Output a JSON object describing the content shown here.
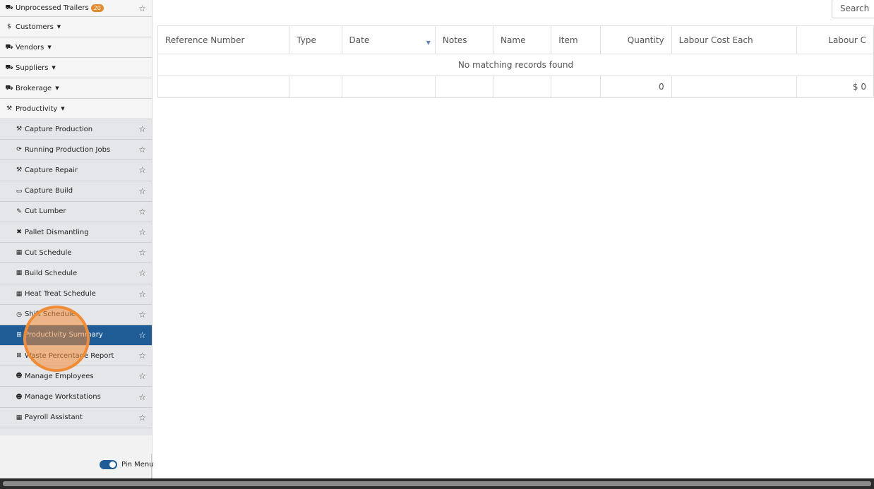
{
  "sidebar": {
    "top_items": [
      {
        "label": "Unprocessed Trailers",
        "icon": "truck-icon",
        "badge": "20",
        "starred": true
      },
      {
        "label": "Customers",
        "icon": "dollar-icon"
      },
      {
        "label": "Vendors",
        "icon": "truck-icon"
      },
      {
        "label": "Suppliers",
        "icon": "truck-icon"
      },
      {
        "label": "Brokerage",
        "icon": "truck-icon"
      },
      {
        "label": "Productivity",
        "icon": "hammer-icon"
      }
    ],
    "productivity_items": [
      {
        "label": "Capture Production",
        "icon": "hammer-icon"
      },
      {
        "label": "Running Production Jobs",
        "icon": "refresh-icon"
      },
      {
        "label": "Capture Repair",
        "icon": "hammer-icon"
      },
      {
        "label": "Capture Build",
        "icon": "ruler-icon"
      },
      {
        "label": "Cut Lumber",
        "icon": "wrench-icon"
      },
      {
        "label": "Pallet Dismantling",
        "icon": "tools-icon"
      },
      {
        "label": "Cut Schedule",
        "icon": "calendar-icon"
      },
      {
        "label": "Build Schedule",
        "icon": "calendar-icon"
      },
      {
        "label": "Heat Treat Schedule",
        "icon": "calendar-icon"
      },
      {
        "label": "Shift Schedule",
        "icon": "clock-icon"
      },
      {
        "label": "Productivity Summary",
        "icon": "table-icon",
        "active": true
      },
      {
        "label": "Waste Percentage Report",
        "icon": "table-icon"
      },
      {
        "label": "Manage Employees",
        "icon": "users-icon"
      },
      {
        "label": "Manage Workstations",
        "icon": "users-icon"
      },
      {
        "label": "Payroll Assistant",
        "icon": "calendar-icon"
      }
    ],
    "pin_menu_label": "Pin Menu"
  },
  "search": {
    "placeholder": "Search"
  },
  "table": {
    "columns": [
      "Reference Number",
      "Type",
      "Date",
      "Notes",
      "Name",
      "Item",
      "Quantity",
      "Labour Cost Each",
      "Labour C"
    ],
    "empty_message": "No matching records found",
    "footer": [
      "",
      "",
      "",
      "",
      "",
      "",
      "0",
      "",
      "$ 0"
    ]
  },
  "colors": {
    "accent": "#1f5c96",
    "badge": "#e38b2c",
    "click_marker": "#f08c37"
  }
}
